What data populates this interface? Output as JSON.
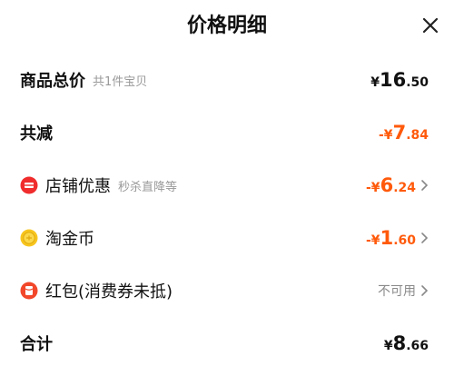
{
  "header": {
    "title": "价格明细"
  },
  "rows": {
    "total_goods": {
      "label": "商品总价",
      "sub": "共1件宝贝",
      "amount": {
        "sym": "¥",
        "int": "16",
        "dec": ".50"
      }
    },
    "discount_total": {
      "label": "共减",
      "amount": {
        "sym": "-¥",
        "int": "7",
        "dec": ".84"
      }
    },
    "shop_discount": {
      "label": "店铺优惠",
      "sub": "秒杀直降等",
      "amount": {
        "sym": "-¥",
        "int": "6",
        "dec": ".24"
      }
    },
    "coins": {
      "label": "淘金币",
      "amount": {
        "sym": "-¥",
        "int": "1",
        "dec": ".60"
      }
    },
    "red_packet": {
      "label": "红包(消费券未抵)",
      "status": "不可用"
    },
    "grand_total": {
      "label": "合计",
      "amount": {
        "sym": "¥",
        "int": "8",
        "dec": ".66"
      }
    }
  },
  "colors": {
    "accent": "#ff5a0b",
    "shop_icon": "#f02c2c",
    "coin_icon": "#f7c51e",
    "redpacket_icon": "#f2472a",
    "muted": "#8a8a8a"
  },
  "icons": {
    "close": "close-icon",
    "chevron": "chevron-right-icon",
    "shop": "shop-discount-icon",
    "coin": "gold-coin-icon",
    "red_packet": "red-packet-icon"
  }
}
